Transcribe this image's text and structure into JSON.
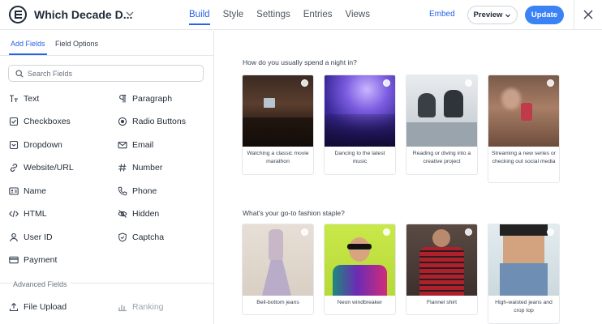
{
  "header": {
    "form_title": "Which Decade D...",
    "nav": [
      "Build",
      "Style",
      "Settings",
      "Entries",
      "Views"
    ],
    "embed": "Embed",
    "preview": "Preview",
    "update": "Update"
  },
  "sidebar": {
    "tabs": [
      "Add Fields",
      "Field Options"
    ],
    "search_placeholder": "Search Fields",
    "fields": [
      {
        "label": "Text",
        "icon": "text-icon"
      },
      {
        "label": "Paragraph",
        "icon": "paragraph-icon"
      },
      {
        "label": "Checkboxes",
        "icon": "checkbox-icon"
      },
      {
        "label": "Radio Buttons",
        "icon": "radio-icon"
      },
      {
        "label": "Dropdown",
        "icon": "dropdown-icon"
      },
      {
        "label": "Email",
        "icon": "email-icon"
      },
      {
        "label": "Website/URL",
        "icon": "link-icon"
      },
      {
        "label": "Number",
        "icon": "hash-icon"
      },
      {
        "label": "Name",
        "icon": "id-card-icon"
      },
      {
        "label": "Phone",
        "icon": "phone-icon"
      },
      {
        "label": "HTML",
        "icon": "code-icon"
      },
      {
        "label": "Hidden",
        "icon": "eye-off-icon"
      },
      {
        "label": "User ID",
        "icon": "user-icon"
      },
      {
        "label": "Captcha",
        "icon": "shield-icon"
      },
      {
        "label": "Payment",
        "icon": "card-icon"
      }
    ],
    "advanced_label": "Advanced Fields",
    "advanced_fields": [
      {
        "label": "File Upload",
        "icon": "upload-icon"
      },
      {
        "label": "Ranking",
        "icon": "ranking-icon"
      }
    ]
  },
  "main": {
    "questions": [
      {
        "label": "How do you usually spend a night in?",
        "options": [
          "Watching a classic movie marathon",
          "Dancing to the latest music",
          "Reading or diving into a creative project",
          "Streaming a new series or checking out social media"
        ]
      },
      {
        "label": "What's your go-to fashion staple?",
        "options": [
          "Bell-bottom jeans",
          "Neon windbreaker",
          "Flannel shirt",
          "High-waisted jeans and crop top"
        ]
      }
    ]
  },
  "colors": {
    "accent": "#2563eb",
    "update_button": "#3b82f6"
  }
}
